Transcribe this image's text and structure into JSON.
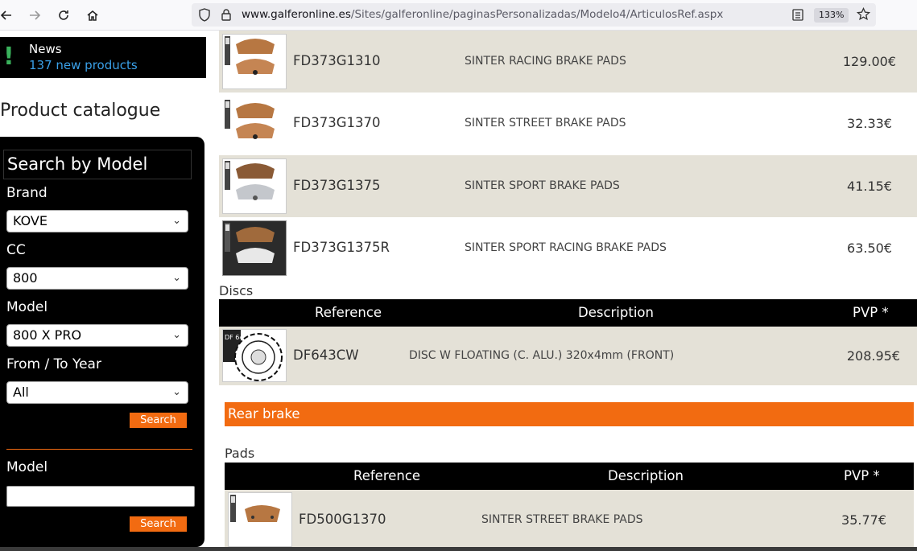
{
  "browser": {
    "url_domain": "www.galferonline.es",
    "url_path": "/Sites/galferonline/paginasPersonalizadas/Modelo4/ArticulosRef.aspx",
    "zoom": "133%",
    "icons": [
      "back-arrow-icon",
      "forward-arrow-icon",
      "reload-icon",
      "home-icon",
      "shield-icon",
      "lock-icon",
      "reader-view-icon",
      "bookmark-star-icon"
    ]
  },
  "news": {
    "label": "News",
    "link": "137 new products"
  },
  "catalogue_title": "Product catalogue",
  "search": {
    "title": "Search by Model",
    "brand_label": "Brand",
    "brand_value": "KOVE",
    "cc_label": "CC",
    "cc_value": "800",
    "model_label": "Model",
    "model_value": "800 X PRO",
    "year_label": "From / To Year",
    "year_value": "All",
    "search_btn": "Search",
    "model2_label": "Model",
    "model2_value": "",
    "search_btn2": "Search"
  },
  "front_pads": [
    {
      "ref": "FD373G1310",
      "desc": "SINTER RACING BRAKE PADS",
      "price": "129.00€"
    },
    {
      "ref": "FD373G1370",
      "desc": "SINTER STREET BRAKE PADS",
      "price": "32.33€"
    },
    {
      "ref": "FD373G1375",
      "desc": "SINTER SPORT BRAKE PADS",
      "price": "41.15€"
    },
    {
      "ref": "FD373G1375R",
      "desc": "SINTER SPORT RACING BRAKE PADS",
      "price": "63.50€"
    }
  ],
  "discs": {
    "label": "Discs",
    "headers": {
      "reference": "Reference",
      "description": "Description",
      "pvp": "PVP *"
    },
    "rows": [
      {
        "ref": "DF643CW",
        "desc": "DISC W FLOATING (C. ALU.) 320x4mm (FRONT)",
        "price": "208.95€",
        "thumb_text": "DF 643 CW"
      }
    ]
  },
  "rear": {
    "title": "Rear brake",
    "pads_label": "Pads",
    "headers": {
      "reference": "Reference",
      "description": "Description",
      "pvp": "PVP *"
    },
    "rows": [
      {
        "ref": "FD500G1370",
        "desc": "SINTER STREET BRAKE PADS",
        "price": "35.77€"
      }
    ]
  },
  "colors": {
    "accent_orange": "#f26b11",
    "row_gray": "#e4e1d7",
    "news_blue": "#3aa0e8"
  }
}
